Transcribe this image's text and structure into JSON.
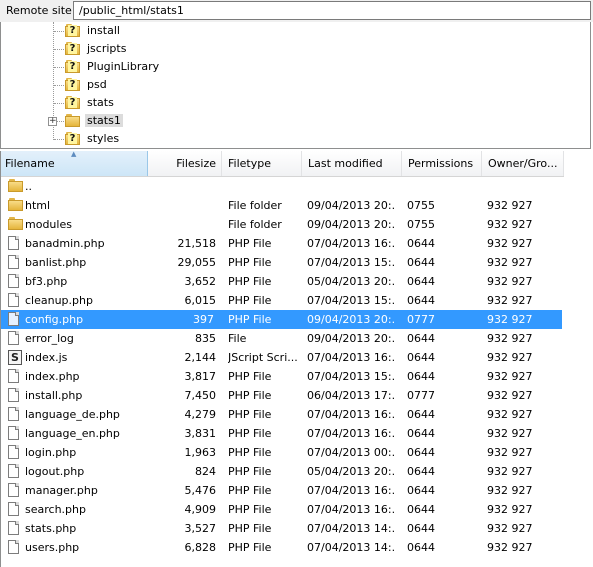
{
  "remote_site": {
    "label": "Remote site:",
    "path": "/public_html/stats1"
  },
  "tree": [
    {
      "name": "install",
      "icon": "unknown-folder-icon"
    },
    {
      "name": "jscripts",
      "icon": "unknown-folder-icon"
    },
    {
      "name": "PluginLibrary",
      "icon": "unknown-folder-icon"
    },
    {
      "name": "psd",
      "icon": "unknown-folder-icon"
    },
    {
      "name": "stats",
      "icon": "unknown-folder-icon"
    },
    {
      "name": "stats1",
      "icon": "folder-icon",
      "expander": "+"
    },
    {
      "name": "styles",
      "icon": "unknown-folder-icon"
    }
  ],
  "columns": {
    "filename": "Filename",
    "filesize": "Filesize",
    "filetype": "Filetype",
    "last_modified": "Last modified",
    "permissions": "Permissions",
    "owner": "Owner/Gro..."
  },
  "files": [
    {
      "name": "..",
      "size": "",
      "type": "",
      "modified": "",
      "perms": "",
      "owner": "",
      "icon": "folder-icon"
    },
    {
      "name": "html",
      "size": "",
      "type": "File folder",
      "modified": "09/04/2013 20:...",
      "perms": "0755",
      "owner": "932 927",
      "icon": "folder-icon"
    },
    {
      "name": "modules",
      "size": "",
      "type": "File folder",
      "modified": "09/04/2013 20:...",
      "perms": "0755",
      "owner": "932 927",
      "icon": "folder-icon"
    },
    {
      "name": "banadmin.php",
      "size": "21,518",
      "type": "PHP File",
      "modified": "07/04/2013 16:...",
      "perms": "0644",
      "owner": "932 927",
      "icon": "document-icon"
    },
    {
      "name": "banlist.php",
      "size": "29,055",
      "type": "PHP File",
      "modified": "07/04/2013 15:...",
      "perms": "0644",
      "owner": "932 927",
      "icon": "document-icon"
    },
    {
      "name": "bf3.php",
      "size": "3,652",
      "type": "PHP File",
      "modified": "05/04/2013 20:...",
      "perms": "0644",
      "owner": "932 927",
      "icon": "document-icon"
    },
    {
      "name": "cleanup.php",
      "size": "6,015",
      "type": "PHP File",
      "modified": "07/04/2013 15:...",
      "perms": "0644",
      "owner": "932 927",
      "icon": "document-icon"
    },
    {
      "name": "config.php",
      "size": "397",
      "type": "PHP File",
      "modified": "09/04/2013 20:...",
      "perms": "0777",
      "owner": "932 927",
      "icon": "document-icon",
      "selected": true
    },
    {
      "name": "error_log",
      "size": "835",
      "type": "File",
      "modified": "09/04/2013 20:...",
      "perms": "0644",
      "owner": "932 927",
      "icon": "document-icon"
    },
    {
      "name": "index.js",
      "size": "2,144",
      "type": "JScript Scri...",
      "modified": "07/04/2013 16:...",
      "perms": "0644",
      "owner": "932 927",
      "icon": "jscript-icon"
    },
    {
      "name": "index.php",
      "size": "3,817",
      "type": "PHP File",
      "modified": "07/04/2013 15:...",
      "perms": "0644",
      "owner": "932 927",
      "icon": "document-icon"
    },
    {
      "name": "install.php",
      "size": "7,450",
      "type": "PHP File",
      "modified": "06/04/2013 17:...",
      "perms": "0777",
      "owner": "932 927",
      "icon": "document-icon"
    },
    {
      "name": "language_de.php",
      "size": "4,279",
      "type": "PHP File",
      "modified": "07/04/2013 16:...",
      "perms": "0644",
      "owner": "932 927",
      "icon": "document-icon"
    },
    {
      "name": "language_en.php",
      "size": "3,831",
      "type": "PHP File",
      "modified": "07/04/2013 16:...",
      "perms": "0644",
      "owner": "932 927",
      "icon": "document-icon"
    },
    {
      "name": "login.php",
      "size": "1,963",
      "type": "PHP File",
      "modified": "07/04/2013 00:...",
      "perms": "0644",
      "owner": "932 927",
      "icon": "document-icon"
    },
    {
      "name": "logout.php",
      "size": "824",
      "type": "PHP File",
      "modified": "05/04/2013 20:...",
      "perms": "0644",
      "owner": "932 927",
      "icon": "document-icon"
    },
    {
      "name": "manager.php",
      "size": "5,476",
      "type": "PHP File",
      "modified": "07/04/2013 16:...",
      "perms": "0644",
      "owner": "932 927",
      "icon": "document-icon"
    },
    {
      "name": "search.php",
      "size": "4,909",
      "type": "PHP File",
      "modified": "07/04/2013 16:...",
      "perms": "0644",
      "owner": "932 927",
      "icon": "document-icon"
    },
    {
      "name": "stats.php",
      "size": "3,527",
      "type": "PHP File",
      "modified": "07/04/2013 14:...",
      "perms": "0644",
      "owner": "932 927",
      "icon": "document-icon"
    },
    {
      "name": "users.php",
      "size": "6,828",
      "type": "PHP File",
      "modified": "07/04/2013 14:...",
      "perms": "0644",
      "owner": "932 927",
      "icon": "document-icon"
    }
  ],
  "colors": {
    "selection": "#3399ff",
    "sorted_header": "#cde6f7",
    "folder": "#f8dc88"
  }
}
